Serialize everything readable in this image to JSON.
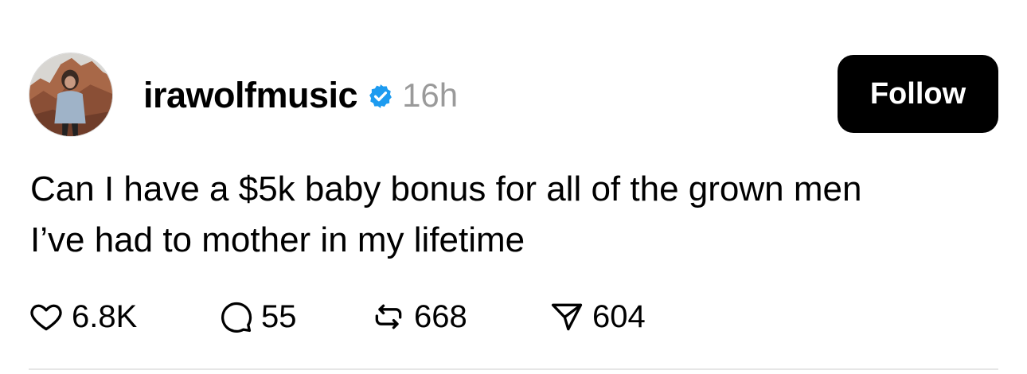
{
  "post": {
    "author": {
      "username": "irawolfmusic",
      "verified_icon": "verified-badge-icon",
      "avatar_icon": "avatar"
    },
    "timestamp": "16h",
    "follow_label": "Follow",
    "text_lines": [
      "Can I have a $5k baby bonus for all of the grown men",
      "I’ve had to mother in my lifetime"
    ],
    "actions": {
      "like": {
        "icon": "heart-icon",
        "count": "6.8K"
      },
      "reply": {
        "icon": "comment-icon",
        "count": "55"
      },
      "repost": {
        "icon": "repost-icon",
        "count": "668"
      },
      "share": {
        "icon": "send-icon",
        "count": "604"
      }
    },
    "colors": {
      "verified": "#1D9BF0",
      "timestamp": "#9A9A9A",
      "button_bg": "#000000",
      "button_text": "#FFFFFF",
      "divider": "#E6E6E6"
    }
  }
}
